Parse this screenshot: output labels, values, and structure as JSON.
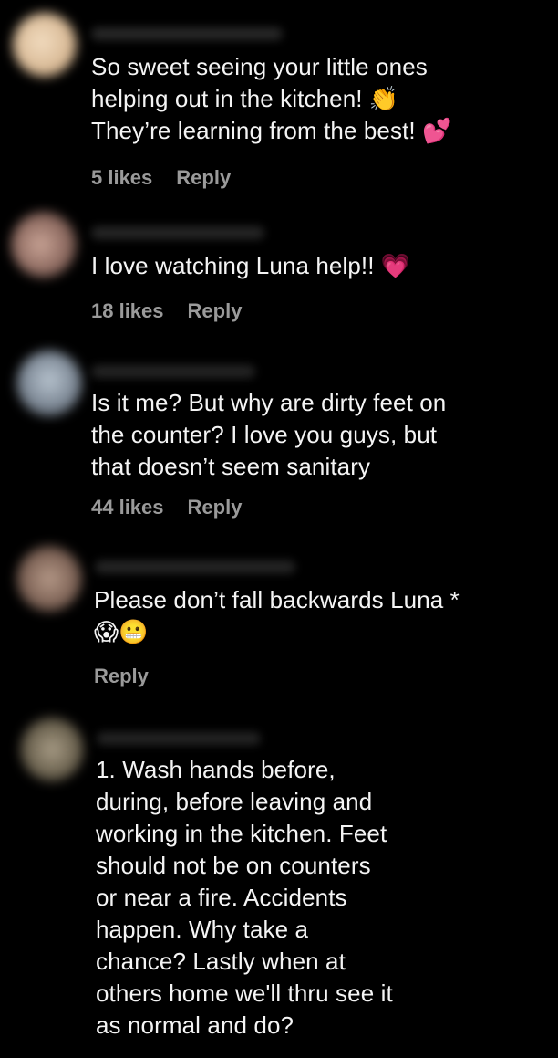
{
  "colors": {
    "background": "#000000",
    "text": "#f4f4f4",
    "meta": "#9a9a9a"
  },
  "comments": [
    {
      "text": "So sweet seeing your little ones\nhelping out in the kitchen! 👏\nThey’re learning from the best! 💕",
      "likes": "5 likes",
      "reply": "Reply"
    },
    {
      "text": "I love watching Luna help!! 💗",
      "likes": "18 likes",
      "reply": "Reply"
    },
    {
      "text": "Is it me? But why are dirty feet on\nthe counter? I love you guys, but\nthat doesn’t seem sanitary",
      "likes": "44 likes",
      "reply": "Reply"
    },
    {
      "text": "Please don’t fall backwards Luna *\n😱😬",
      "likes": "",
      "reply": "Reply"
    },
    {
      "text": "1. Wash hands before,\nduring, before leaving and\nworking in the kitchen. Feet\nshould not be on counters\nor near a fire. Accidents\nhappen. Why take a\nchance? Lastly when at\nothers home we'll thru see it\nas normal and do?",
      "likes": "",
      "reply": ""
    }
  ]
}
